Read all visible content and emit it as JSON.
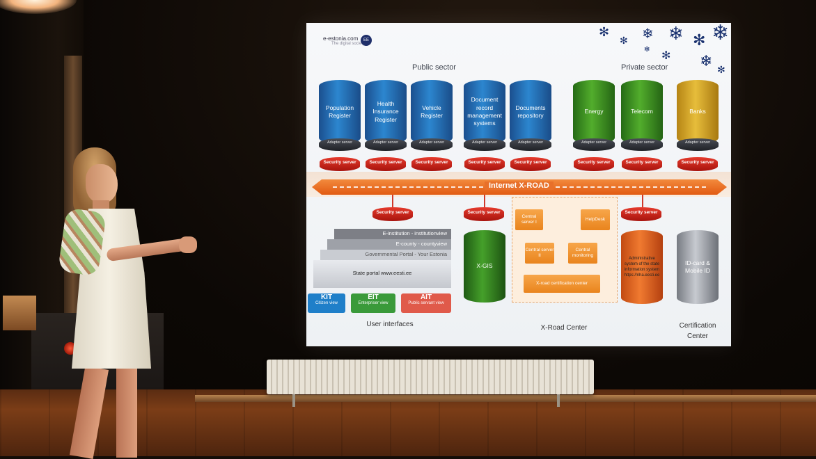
{
  "slide": {
    "brand": "e-estonia.com",
    "brand_tagline": "The digital society",
    "headings": {
      "public": "Public sector",
      "private": "Private sector",
      "ui": "User interfaces",
      "center": "X-Road Center",
      "cert": "Certification Center"
    },
    "registers": [
      "Population Register",
      "Health Insurance Register",
      "Vehicle Register",
      "Document record management systems",
      "Documents repository",
      "Energy",
      "Telecom",
      "Banks"
    ],
    "adapter_label": "Adapter server",
    "security_label": "Security server",
    "xroad_label": "Internet    X-ROAD",
    "central": {
      "server1": "Central server I",
      "server2": "Central server II",
      "monitoring": "Central monitoring",
      "helpdesk": "HelpDesk",
      "cert_center": "X-road certification center"
    },
    "portal": {
      "einst": "E-institution - institutionview",
      "ecounty": "E-county - countyview",
      "gov": "Governmental Portal - Your Estonia",
      "state": "State portal www.eesti.ee"
    },
    "views": [
      {
        "name": "KIT",
        "sub": "Citizen view",
        "color": "#1f7fc9"
      },
      {
        "name": "EIT",
        "sub": "Enterpriser view",
        "color": "#3a9a3a"
      },
      {
        "name": "AIT",
        "sub": "Public servant view",
        "color": "#e05a4a"
      }
    ],
    "xgis": "X-GIS",
    "admin": "Administrative system of the state information system https://riha.eesti.ee",
    "idcard": "ID-card & Mobile ID"
  }
}
